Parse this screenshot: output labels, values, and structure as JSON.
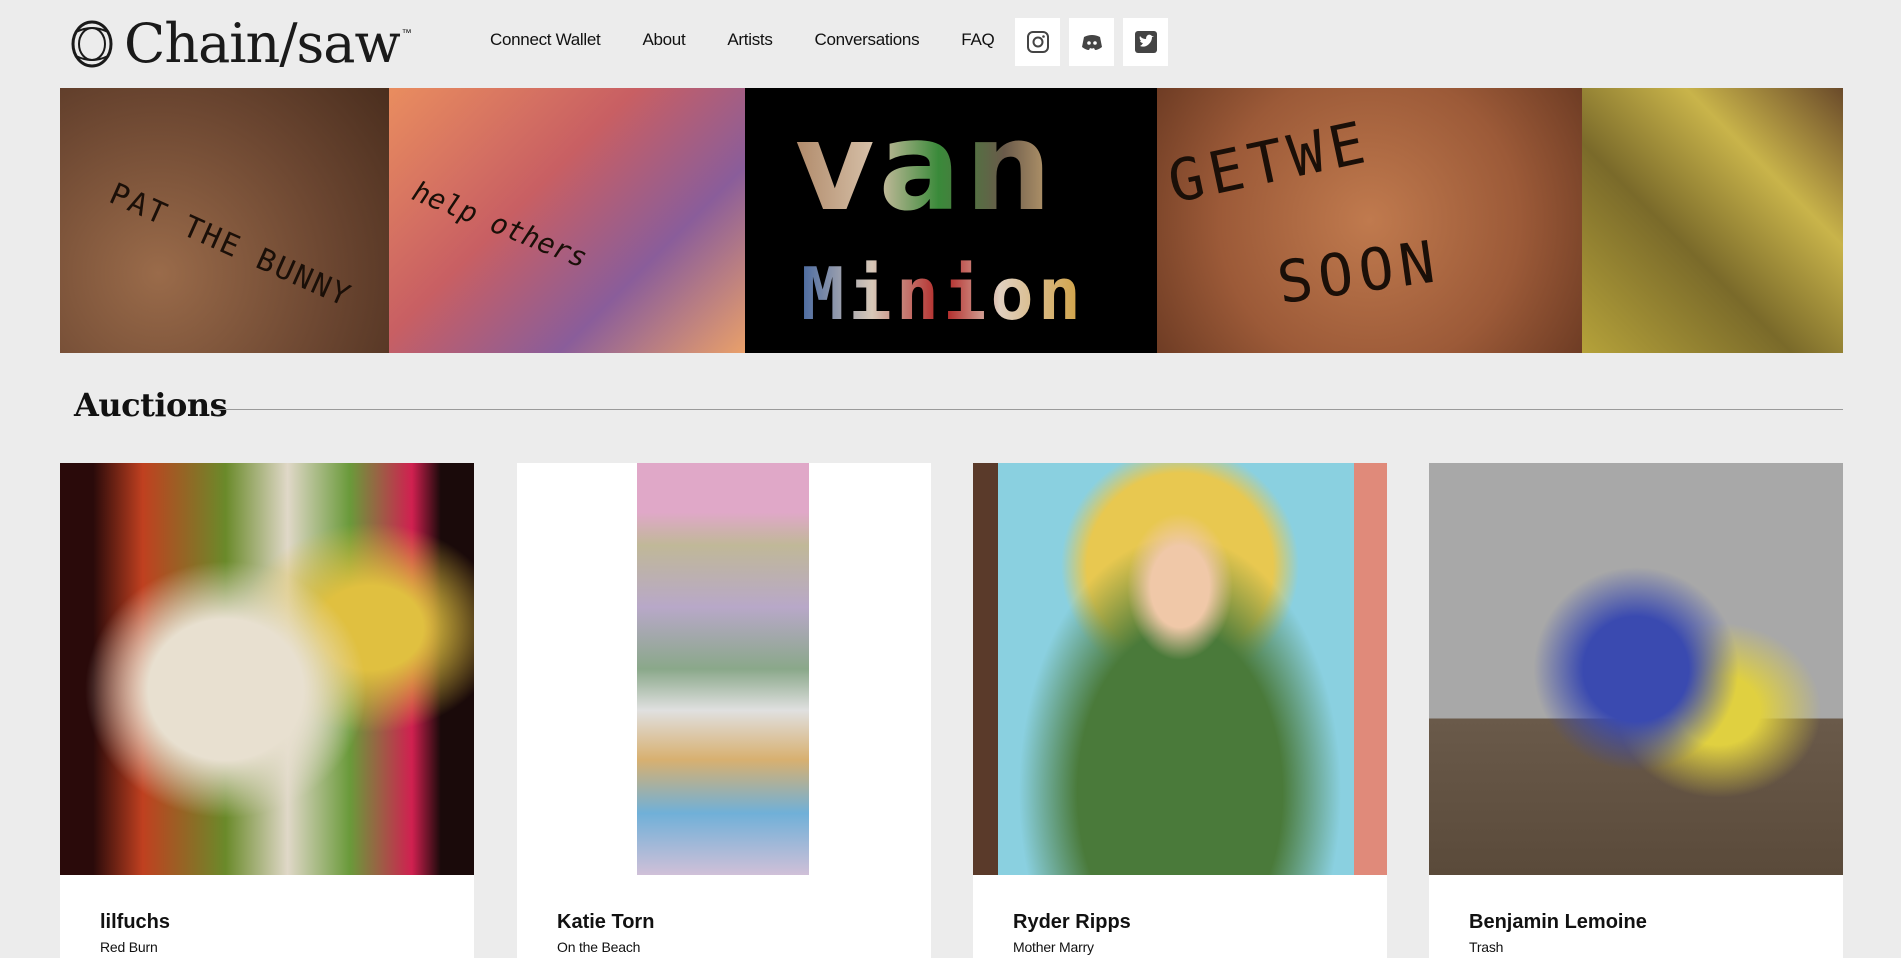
{
  "header": {
    "logo_text": "Chain/saw",
    "logo_tm": "™",
    "nav": [
      {
        "label": "Connect Wallet"
      },
      {
        "label": "About"
      },
      {
        "label": "Artists"
      },
      {
        "label": "Conversations"
      },
      {
        "label": "FAQ"
      }
    ],
    "socials": [
      {
        "icon": "instagram-icon"
      },
      {
        "icon": "discord-icon"
      },
      {
        "icon": "twitter-icon"
      }
    ]
  },
  "banner": {
    "panels": [
      {
        "text": "PAT THE BUNNY"
      },
      {
        "text": "help others"
      },
      {
        "text_top": "van",
        "text_bottom": "Minion"
      },
      {
        "text_top": "GETWE",
        "text_bottom": "SOON"
      },
      {
        "text": ""
      }
    ]
  },
  "auctions": {
    "title": "Auctions",
    "cards": [
      {
        "artist": "lilfuchs",
        "title": "Red Burn"
      },
      {
        "artist": "Katie Torn",
        "title": "On the Beach"
      },
      {
        "artist": "Ryder Ripps",
        "title": "Mother Marry"
      },
      {
        "artist": "Benjamin Lemoine",
        "title": "Trash"
      }
    ]
  }
}
